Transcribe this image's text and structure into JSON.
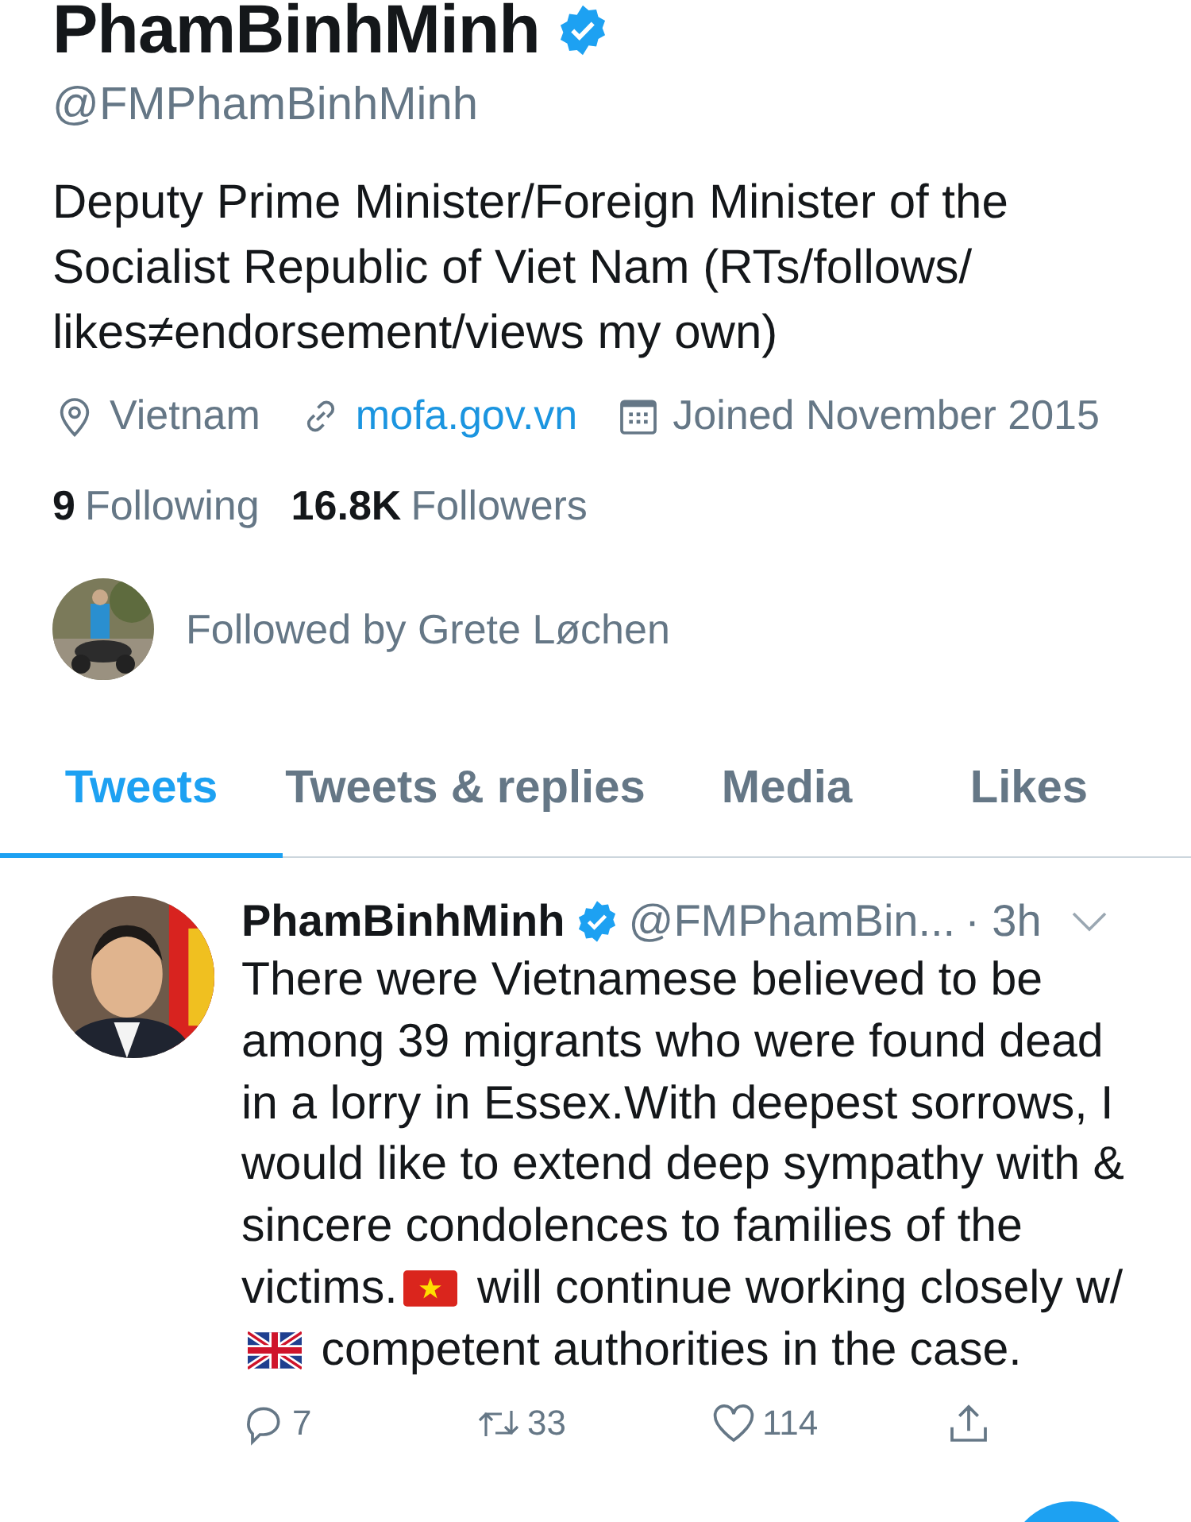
{
  "profile": {
    "name": "PhamBinhMinh",
    "verified": true,
    "handle": "@FMPhamBinhMinh",
    "bio": "Deputy Prime Minister/Foreign Minister of the Socialist Republic of Viet Nam (RTs/follows/ likes≠endorsement/views my own)",
    "location": "Vietnam",
    "website": "mofa.gov.vn",
    "joined": "Joined November 2015",
    "following_count": "9",
    "following_label": "Following",
    "followers_count": "16.8K",
    "followers_label": "Followers",
    "followed_by": "Followed by Grete Løchen"
  },
  "tabs": [
    {
      "label": "Tweets",
      "selected": true
    },
    {
      "label": "Tweets & replies",
      "selected": false
    },
    {
      "label": "Media",
      "selected": false
    },
    {
      "label": "Likes",
      "selected": false
    }
  ],
  "tweet": {
    "name": "PhamBinhMinh",
    "verified": true,
    "handle": "@FMPhamBin...",
    "time": "· 3h",
    "text_parts": [
      {
        "kind": "text",
        "text": "There were Vietnamese believed to be among 39 migrants who were found dead in a lorry in Essex.With deepest sorrows, I would like to extend deep sympathy with & sincere condolences to families of the victims."
      },
      {
        "kind": "vietnam_flag"
      },
      {
        "kind": "text",
        "text": " will continue working closely w/"
      },
      {
        "kind": "uk_flag"
      },
      {
        "kind": "text",
        "text": " competent authorities in the case."
      }
    ],
    "replies": "7",
    "retweets": "33",
    "likes": "114"
  }
}
